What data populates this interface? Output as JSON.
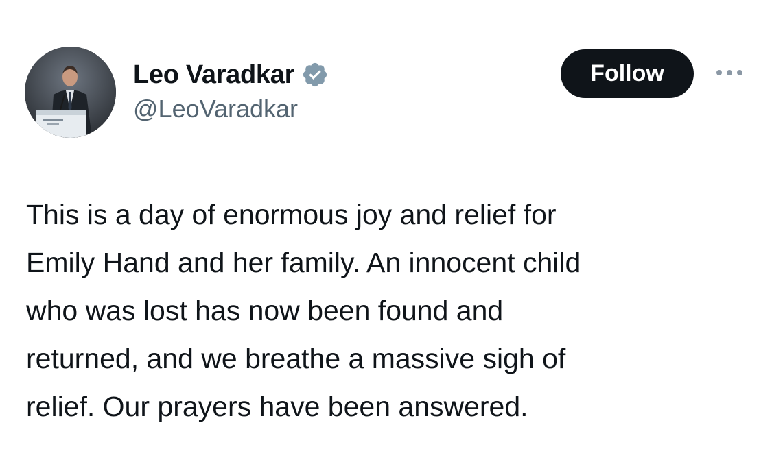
{
  "author": {
    "display_name": "Leo Varadkar",
    "handle": "@LeoVaradkar",
    "verified": true,
    "verified_badge_color": "#829aab"
  },
  "actions": {
    "follow_label": "Follow",
    "more_icon": "more-horizontal-icon"
  },
  "post": {
    "text": "This is a day of enormous joy and relief for\nEmily Hand and her family. An innocent child\nwho was lost has now been found and\nreturned, and we breathe a massive sigh of\nrelief.  Our prayers have been answered."
  },
  "colors": {
    "text_primary": "#0f1419",
    "text_secondary": "#536471",
    "follow_bg": "#0f1419",
    "follow_text": "#ffffff",
    "background": "#ffffff"
  }
}
